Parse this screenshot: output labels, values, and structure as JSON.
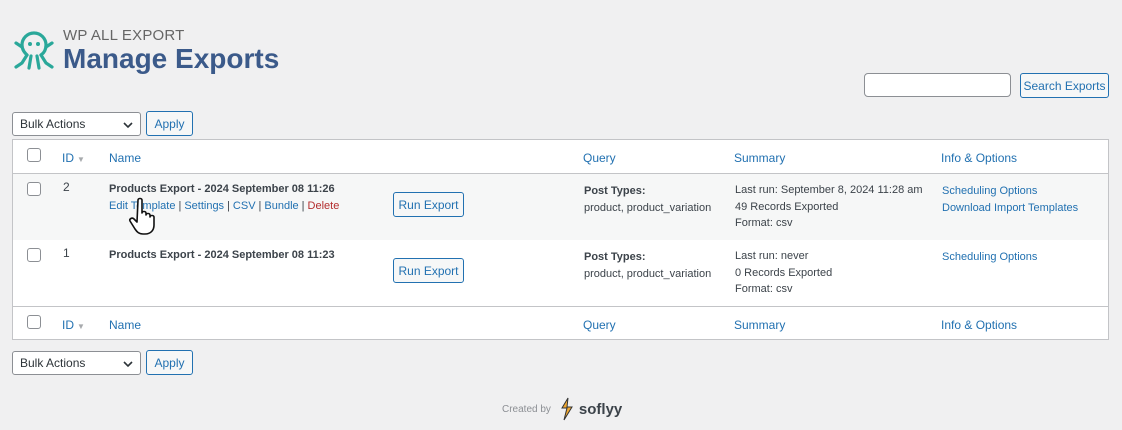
{
  "brand": {
    "small_title": "WP ALL EXPORT",
    "page_title": "Manage Exports"
  },
  "search": {
    "button_label": "Search Exports",
    "placeholder": ""
  },
  "bulk_top": {
    "selected": "Bulk Actions",
    "apply_label": "Apply"
  },
  "bulk_bottom": {
    "selected": "Bulk Actions",
    "apply_label": "Apply"
  },
  "table": {
    "columns": {
      "id": "ID",
      "name": "Name",
      "query": "Query",
      "summary": "Summary",
      "info": "Info & Options"
    },
    "rows": [
      {
        "id": "2",
        "name": "Products Export - 2024 September 08 11:26",
        "actions": {
          "edit": "Edit Template",
          "settings": "Settings",
          "csv": "CSV",
          "bundle": "Bundle",
          "delete": "Delete",
          "sep": "|"
        },
        "run_label": "Run Export",
        "query_label": "Post Types:",
        "query_value": "product, product_variation",
        "summary": [
          "Last run: September 8, 2024 11:28 am",
          "49 Records Exported",
          "Format: csv"
        ],
        "info": [
          "Scheduling Options",
          "Download Import Templates"
        ]
      },
      {
        "id": "1",
        "name": "Products Export - 2024 September 08 11:23",
        "run_label": "Run Export",
        "query_label": "Post Types:",
        "query_value": "product, product_variation",
        "summary": [
          "Last run: never",
          "0 Records Exported",
          "Format: csv"
        ],
        "info": [
          "Scheduling Options"
        ]
      }
    ]
  },
  "footer": {
    "created_by": "Created by",
    "brand": "soflyy"
  },
  "colors": {
    "accent": "#2271b1",
    "title": "#3b5a8a",
    "logo": "#2aa89a",
    "delete": "#b32d2e"
  }
}
